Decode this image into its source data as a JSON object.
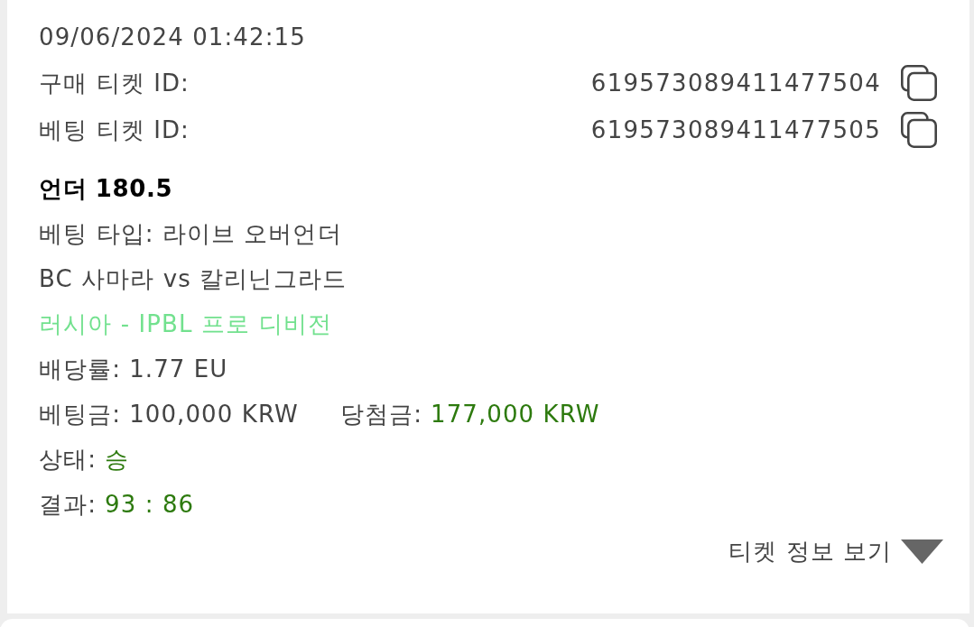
{
  "ticket": {
    "datetime": "09/06/2024 01:42:15",
    "ids": [
      {
        "label": "구매 티켓 ID:",
        "value": "619573089411477504"
      },
      {
        "label": "베팅 티켓 ID:",
        "value": "619573089411477505"
      }
    ],
    "selection": "언더 180.5",
    "bet_type": {
      "label": "베팅 타입:",
      "value": "라이브 오버언더"
    },
    "match": "BC 사마라 vs 칼리닌그라드",
    "league": "러시아 - IPBL 프로 디비전",
    "odds": {
      "label": "배당률:",
      "value": "1.77 EU"
    },
    "stake": {
      "label": "베팅금:",
      "value": "100,000 KRW"
    },
    "payout": {
      "label": "당첨금:",
      "value": "177,000 KRW"
    },
    "status": {
      "label": "상태:",
      "value": "승"
    },
    "result": {
      "label": "결과:",
      "value": "93 : 86"
    },
    "details_toggle": {
      "label": "티켓 정보 보기",
      "expanded": false
    }
  }
}
